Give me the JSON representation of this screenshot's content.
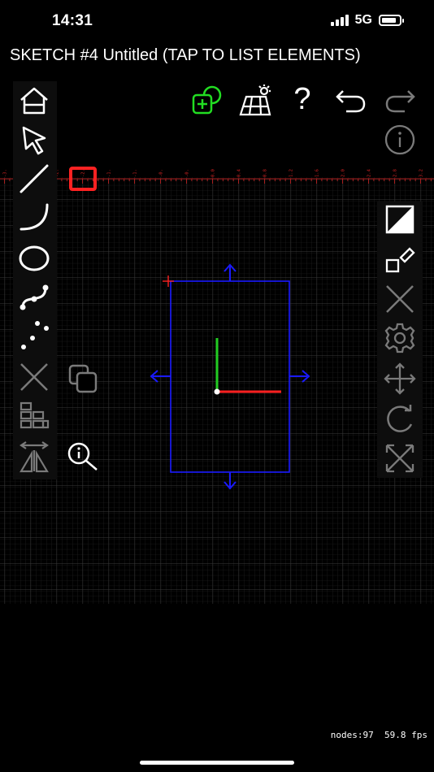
{
  "status_bar": {
    "time": "14:31",
    "network": "5G",
    "battery_level": 0.85
  },
  "title": "SKETCH #4 Untitled (TAP TO LIST ELEMENTS)",
  "ruler": {
    "labels": [
      "-3.20",
      "-2.80",
      "-2.40",
      "-2.00",
      "-1.60",
      "-1.20",
      "-0.80",
      "-0.40",
      "0.00",
      "0.40",
      "0.80",
      "1.20",
      "1.60",
      "2.00",
      "2.40",
      "2.80",
      "3.20"
    ]
  },
  "toolbar_left": [
    {
      "name": "home-icon"
    },
    {
      "name": "select-pointer-icon"
    },
    {
      "name": "line-tool-icon"
    },
    {
      "name": "arc-tool-icon"
    },
    {
      "name": "ellipse-tool-icon"
    },
    {
      "name": "spline-tool-icon"
    },
    {
      "name": "points-tool-icon"
    },
    {
      "name": "delete-x-icon"
    },
    {
      "name": "blocks-icon"
    },
    {
      "name": "mirror-icon"
    }
  ],
  "toolbar_top": [
    {
      "name": "add-shape-icon",
      "color": "#22dd22"
    },
    {
      "name": "solar-panel-icon"
    },
    {
      "name": "help-icon",
      "label": "?"
    },
    {
      "name": "undo-icon"
    },
    {
      "name": "redo-icon"
    },
    {
      "name": "info-icon"
    }
  ],
  "toolbar_right": [
    {
      "name": "fill-toggle-icon"
    },
    {
      "name": "edit-shape-icon"
    },
    {
      "name": "close-x-icon"
    },
    {
      "name": "gear-icon"
    },
    {
      "name": "move-icon"
    },
    {
      "name": "rotate-icon"
    },
    {
      "name": "scale-icon"
    }
  ],
  "colors": {
    "background": "#000000",
    "grid": "#3a3a3a",
    "ruler": "#cc2222",
    "rectangle": "#1a1aff",
    "axis_x": "#ff2020",
    "axis_y": "#22cc22",
    "active_tool": "#ff2222",
    "disabled": "#7a7a7a"
  },
  "footer": {
    "stats": "nodes:97  59.8 fps"
  }
}
